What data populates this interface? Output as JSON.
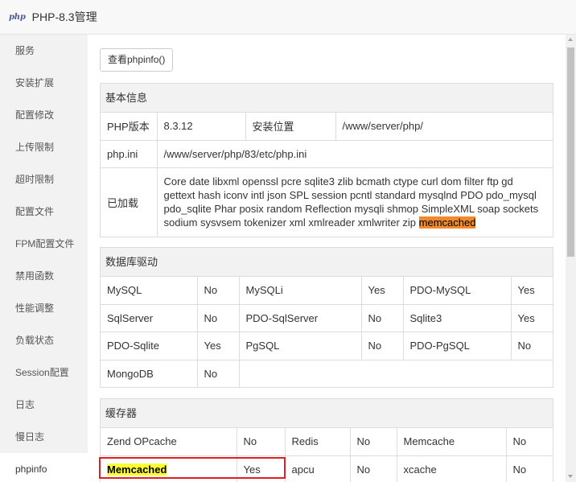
{
  "window": {
    "logo_text": "php",
    "title": "PHP-8.3管理"
  },
  "sidebar": {
    "items": [
      {
        "label": "服务"
      },
      {
        "label": "安装扩展"
      },
      {
        "label": "配置修改"
      },
      {
        "label": "上传限制"
      },
      {
        "label": "超时限制"
      },
      {
        "label": "配置文件"
      },
      {
        "label": "FPM配置文件"
      },
      {
        "label": "禁用函数"
      },
      {
        "label": "性能调整"
      },
      {
        "label": "负载状态"
      },
      {
        "label": "Session配置"
      },
      {
        "label": "日志"
      },
      {
        "label": "慢日志"
      },
      {
        "label": "phpinfo"
      }
    ],
    "active_index": 13
  },
  "main": {
    "view_phpinfo_button": "查看phpinfo()",
    "basic_info": {
      "title": "基本信息",
      "version_label": "PHP版本",
      "version_value": "8.3.12",
      "install_label": "安装位置",
      "install_value": "/www/server/php/",
      "ini_label": "php.ini",
      "ini_value": "/www/server/php/83/etc/php.ini",
      "loaded_label": "已加载",
      "loaded_text": "Core date libxml openssl pcre sqlite3 zlib bcmath ctype curl dom filter ftp gd gettext hash iconv intl json SPL session pcntl standard mysqlnd PDO pdo_mysql pdo_sqlite Phar posix random Reflection mysqli shmop SimpleXML soap sockets sodium sysvsem tokenizer xml xmlreader xmlwriter zip",
      "loaded_highlight": "memcached"
    },
    "db_drivers": {
      "title": "数据库驱动",
      "rows": [
        [
          {
            "name": "MySQL",
            "status": "No"
          },
          {
            "name": "MySQLi",
            "status": "Yes"
          },
          {
            "name": "PDO-MySQL",
            "status": "Yes"
          }
        ],
        [
          {
            "name": "SqlServer",
            "status": "No"
          },
          {
            "name": "PDO-SqlServer",
            "status": "No"
          },
          {
            "name": "Sqlite3",
            "status": "Yes"
          }
        ],
        [
          {
            "name": "PDO-Sqlite",
            "status": "Yes"
          },
          {
            "name": "PgSQL",
            "status": "No"
          },
          {
            "name": "PDO-PgSQL",
            "status": "No"
          }
        ],
        [
          {
            "name": "MongoDB",
            "status": "No"
          }
        ]
      ]
    },
    "cache": {
      "title": "缓存器",
      "rows": [
        [
          {
            "name": "Zend OPcache",
            "status": "No"
          },
          {
            "name": "Redis",
            "status": "No"
          },
          {
            "name": "Memcache",
            "status": "No"
          }
        ],
        [
          {
            "name": "Memcached",
            "status": "Yes"
          },
          {
            "name": "apcu",
            "status": "No"
          },
          {
            "name": "xcache",
            "status": "No"
          }
        ]
      ]
    }
  },
  "colors": {
    "no": "#ff0000",
    "yes": "#009900",
    "highlight_orange": "#f08a2c",
    "highlight_yellow": "#ffff33",
    "callout_border": "#e02020"
  }
}
